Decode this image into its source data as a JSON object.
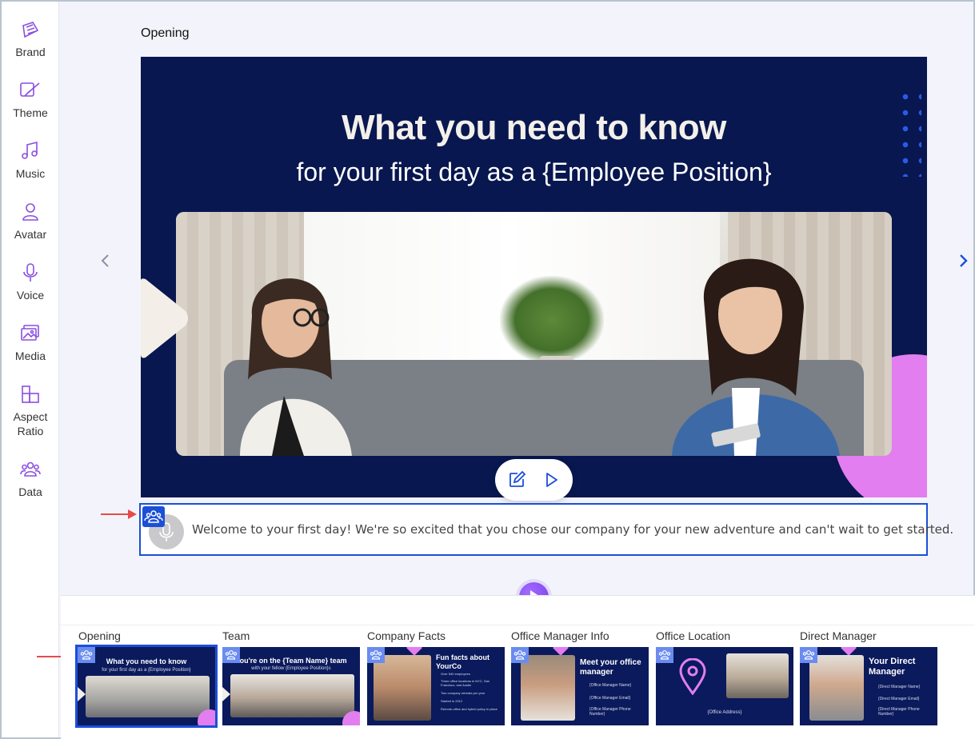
{
  "sidebar": {
    "items": [
      {
        "label": "Brand",
        "icon": "brand-icon"
      },
      {
        "label": "Theme",
        "icon": "theme-icon"
      },
      {
        "label": "Music",
        "icon": "music-icon"
      },
      {
        "label": "Avatar",
        "icon": "avatar-icon"
      },
      {
        "label": "Voice",
        "icon": "voice-icon"
      },
      {
        "label": "Media",
        "icon": "media-icon"
      },
      {
        "label": "Aspect Ratio",
        "icon": "aspect-ratio-icon"
      },
      {
        "label": "Data",
        "icon": "data-icon"
      }
    ],
    "icon_color": "#8a4fe0"
  },
  "editor": {
    "scene_title": "Opening",
    "slide": {
      "heading": "What you need to know",
      "subheading": "for your first day as a {Employee Position}"
    },
    "script": "Welcome to your first day! We're so excited that you chose our company for your new adventure and can't wait to get started."
  },
  "timeline": {
    "scenes": [
      {
        "label": "Opening",
        "thumb_title": "What you need to know",
        "thumb_sub": "for your first day as a {Employee Position}",
        "selected": true
      },
      {
        "label": "Team",
        "thumb_title": "You're on the {Team Name} team",
        "thumb_sub": "with your fellow {Employee Position}s",
        "selected": false
      },
      {
        "label": "Company Facts",
        "thumb_title": "Fun facts about YourCo",
        "thumb_items": [
          "Over 540 employees",
          "Three office locations in NYC, San Francisco, and Austin",
          "Two company retreats per year",
          "Started in 2012",
          "Remote-office and hybrid policy in place"
        ],
        "selected": false
      },
      {
        "label": "Office Manager Info",
        "thumb_title": "Meet your office manager",
        "thumb_items": [
          "{Office Manager Name}",
          "{Office Manager Email}",
          "{Office Manager Phone Number}"
        ],
        "selected": false
      },
      {
        "label": "Office Location",
        "thumb_caption": "{Office Address}",
        "selected": false
      },
      {
        "label": "Direct Manager",
        "thumb_title": "Your Direct Manager",
        "thumb_items": [
          "{Direct Manager Name}",
          "{Direct Manager Email}",
          "{Direct Manager Phone Number}"
        ],
        "selected": false
      }
    ]
  },
  "colors": {
    "slide_bg": "#08174f",
    "accent_blue": "#1b4fd8",
    "accent_pink": "#e27ef0",
    "play_purple": "#7a3ee8",
    "annotation_red": "#e84a4a"
  }
}
